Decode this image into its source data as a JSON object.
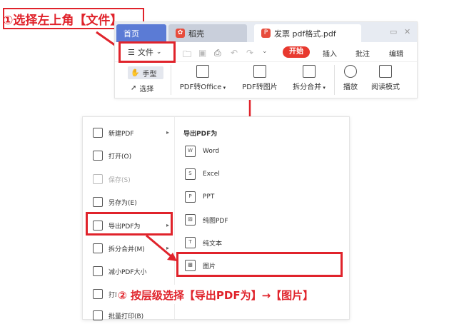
{
  "annotations": {
    "step1": "①选择左上角【文件】",
    "step2": "② 按层级选择【导出PDF为】→【图片】",
    "accent_color": "#e0232b"
  },
  "top": {
    "tabs": [
      {
        "label": "首页",
        "icon": ""
      },
      {
        "label": "稻壳",
        "icon": "daoke-icon"
      },
      {
        "label": "发票 pdf格式.pdf",
        "icon": "pdf-file-icon"
      }
    ],
    "file_menu_label": "文件",
    "menu_items": [
      "开始",
      "插入",
      "批注",
      "编辑"
    ],
    "ribbon": {
      "hand": "手型",
      "select": "选择",
      "pdf_to_office": "PDF转Office",
      "pdf_to_image": "PDF转图片",
      "split_merge": "拆分合并",
      "play": "播放",
      "read_mode": "阅读模式"
    }
  },
  "file_menu": {
    "items": [
      {
        "label": "新建PDF",
        "icon": "new-file-icon",
        "has_arrow": true,
        "disabled": false
      },
      {
        "label": "打开(O)",
        "icon": "folder-icon",
        "has_arrow": false,
        "disabled": false
      },
      {
        "label": "保存(S)",
        "icon": "save-icon",
        "has_arrow": false,
        "disabled": true
      },
      {
        "label": "另存为(E)",
        "icon": "save-as-icon",
        "has_arrow": false,
        "disabled": false
      },
      {
        "label": "导出PDF为",
        "icon": "export-pdf-icon",
        "has_arrow": true,
        "disabled": false
      },
      {
        "label": "拆分合并(M)",
        "icon": "split-merge-icon",
        "has_arrow": true,
        "disabled": false
      },
      {
        "label": "减小PDF大小",
        "icon": "compress-icon",
        "has_arrow": false,
        "disabled": false
      },
      {
        "label": "打印",
        "icon": "print-icon",
        "has_arrow": false,
        "disabled": false
      },
      {
        "label": "批量打印(B)",
        "icon": "batch-print-icon",
        "has_arrow": false,
        "disabled": false
      }
    ],
    "submenu_title": "导出PDF为",
    "submenu_items": [
      {
        "label": "Word",
        "icon": "word-icon"
      },
      {
        "label": "Excel",
        "icon": "excel-icon"
      },
      {
        "label": "PPT",
        "icon": "ppt-icon"
      },
      {
        "label": "纯图PDF",
        "icon": "image-pdf-icon"
      },
      {
        "label": "纯文本",
        "icon": "text-icon"
      },
      {
        "label": "图片",
        "icon": "image-icon"
      }
    ]
  }
}
